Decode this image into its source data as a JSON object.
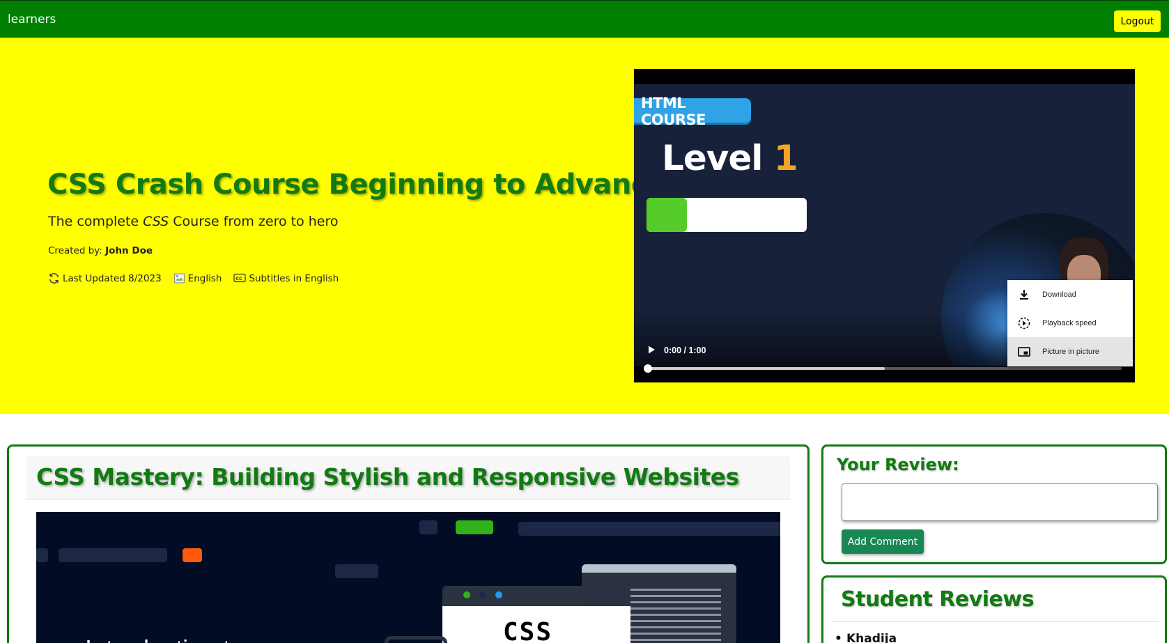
{
  "navbar": {
    "brand": "learners",
    "logout_label": "Logout"
  },
  "hero": {
    "title": "CSS Crash Course Beginning to Advance",
    "subtitle_pre": "The complete ",
    "subtitle_em": "CSS",
    "subtitle_post": " Course from zero to hero",
    "created_label": "Created by:",
    "author": "John Doe",
    "last_updated": "Last Updated 8/2023",
    "language": "English",
    "subtitles": "Subtitles in English"
  },
  "video": {
    "course_tag": "HTML COURSE",
    "level_word": "Level",
    "level_num": "1",
    "level_progress": 0.25,
    "time": "0:00 / 1:00",
    "buffered": 0.5,
    "menu": [
      {
        "label": "Download",
        "icon": "download-icon"
      },
      {
        "label": "Playback speed",
        "icon": "playback-speed-icon"
      },
      {
        "label": "Picture in picture",
        "icon": "picture-in-picture-icon"
      }
    ]
  },
  "course_card": {
    "title": "CSS Mastery: Building Stylish and Responsive Websites",
    "thumb_text": "Introduction to",
    "thumb_logo": "CSS"
  },
  "review": {
    "title": "Your Review:",
    "input_value": "",
    "add_label": "Add Comment"
  },
  "students": {
    "title": "Student Reviews",
    "items": [
      "Khadija"
    ]
  },
  "colors": {
    "nav_green": "#008000",
    "hero_yellow": "#ffff00",
    "title_green": "#127a12",
    "button_green": "#198754"
  }
}
